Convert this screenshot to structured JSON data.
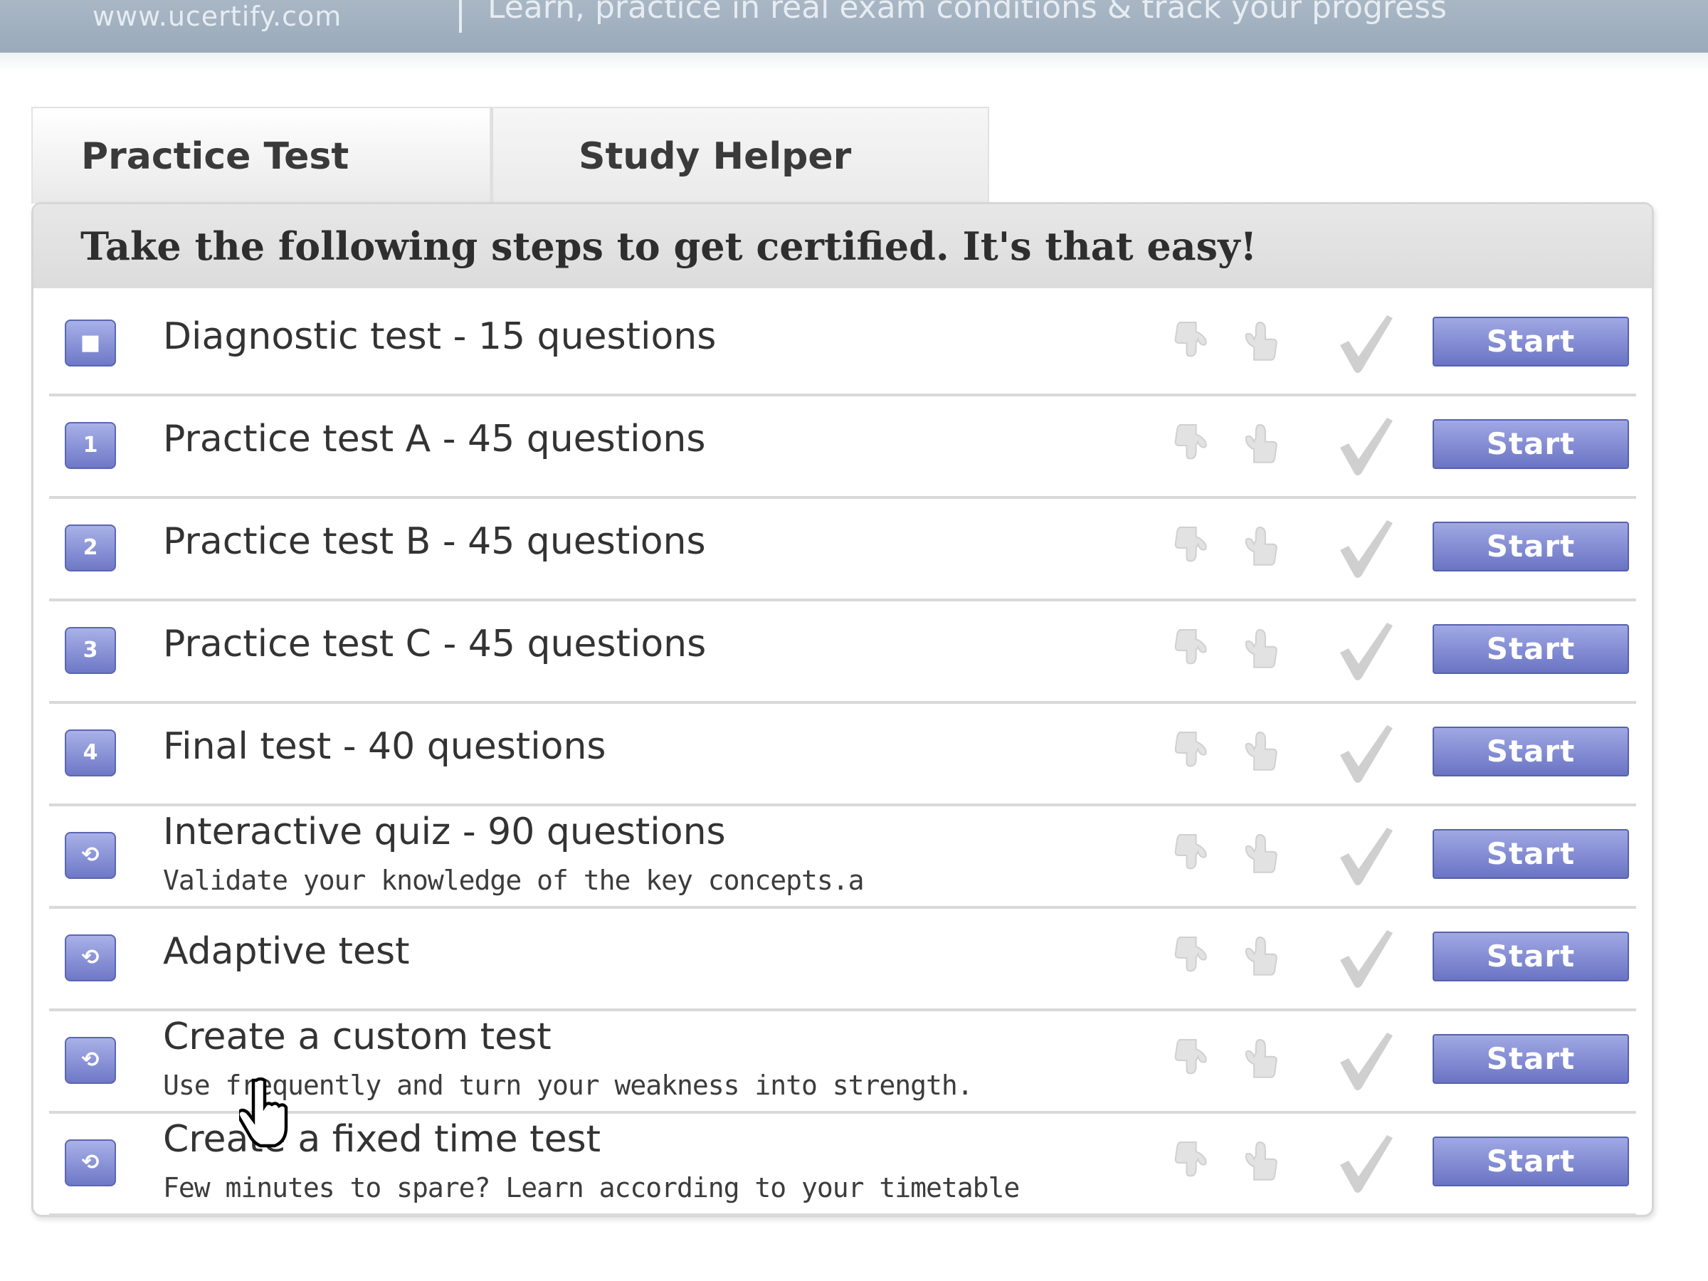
{
  "header": {
    "site": "www.ucertify.com",
    "tagline": "Learn, practice in real exam conditions & track your progress"
  },
  "tabs": [
    {
      "label": "Practice Test",
      "active": true
    },
    {
      "label": "Study Helper",
      "active": false
    }
  ],
  "panel": {
    "heading": "Take the following steps to get certified. It's that easy!"
  },
  "rows": [
    {
      "badge": "■",
      "title": "Diagnostic test - 15 questions",
      "subtitle": "",
      "action": "Start"
    },
    {
      "badge": "1",
      "title": "Practice test A - 45 questions",
      "subtitle": "",
      "action": "Start"
    },
    {
      "badge": "2",
      "title": "Practice test B - 45 questions",
      "subtitle": "",
      "action": "Start"
    },
    {
      "badge": "3",
      "title": "Practice test C - 45 questions",
      "subtitle": "",
      "action": "Start"
    },
    {
      "badge": "4",
      "title": "Final test - 40 questions",
      "subtitle": "",
      "action": "Start"
    },
    {
      "badge": "⟲",
      "title": "Interactive quiz - 90 questions",
      "subtitle": "Validate your knowledge of the key concepts.a",
      "action": "Start"
    },
    {
      "badge": "⟲",
      "title": "Adaptive test",
      "subtitle": "",
      "action": "Start"
    },
    {
      "badge": "⟲",
      "title": "Create a custom test",
      "subtitle": "Use frequently and turn your weakness into strength.",
      "action": "Start"
    },
    {
      "badge": "⟲",
      "title": "Create a fixed time test",
      "subtitle": "Few minutes to spare? Learn according to your timetable",
      "action": "Start"
    }
  ],
  "icons": {
    "thumbs_down": "thumbs-down-icon",
    "thumbs_up": "thumbs-up-icon",
    "check": "checkmark-icon",
    "badge_color": "#6e78c6",
    "button_color": "#7a84cc"
  }
}
